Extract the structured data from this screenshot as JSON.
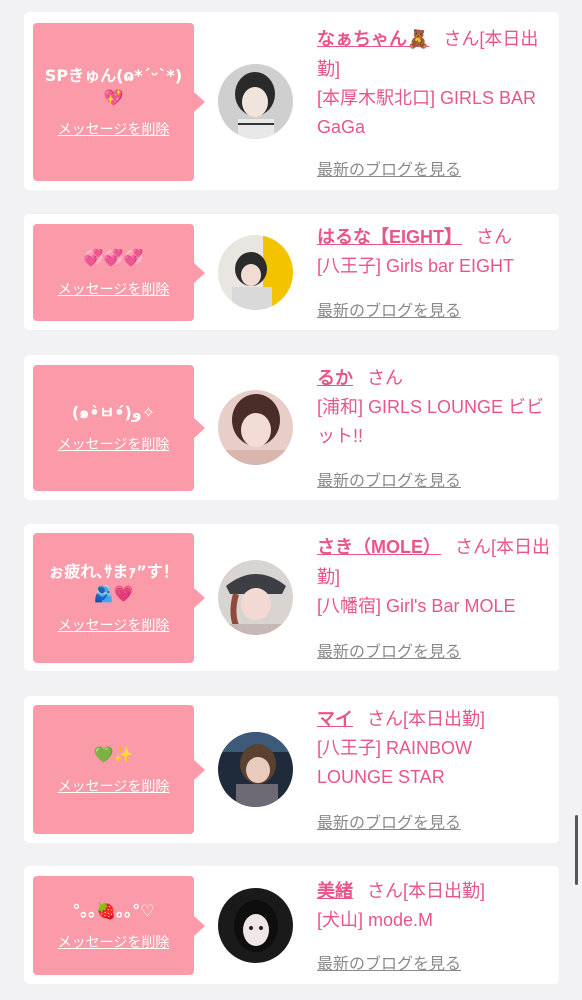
{
  "cards": [
    {
      "message": "SPきゅん(ɷ*ˊᵕˋ*)💖",
      "delete_label": "メッセージを削除",
      "name": "なぁちゃん🧸",
      "honorific": "さん[本日出勤]",
      "shop": "[本厚木駅北口] GIRLS BAR GaGa",
      "blog_label": "最新のブログを見る"
    },
    {
      "message": "💞💞💞",
      "delete_label": "メッセージを削除",
      "name": "はるな【EIGHT】",
      "honorific": "さん",
      "shop": "[八王子] Girls bar EIGHT",
      "blog_label": "最新のブログを見る"
    },
    {
      "message": "(๑•̀ㅂ•́)و✧",
      "delete_label": "メッセージを削除",
      "name": "るか",
      "honorific": "さん",
      "shop": "[浦和] GIRLS LOUNGE ビビット!!",
      "blog_label": "最新のブログを見る"
    },
    {
      "message": "ぉ疲れ､ｻまｧ”す！🫂💗",
      "delete_label": "メッセージを削除",
      "name": "さき（MOLE）",
      "honorific": "さん[本日出勤]",
      "shop": "[八幡宿] Girl's Bar MOLE",
      "blog_label": "最新のブログを見る"
    },
    {
      "message": "💚✨",
      "delete_label": "メッセージを削除",
      "name": "マイ",
      "honorific": "さん[本日出勤]",
      "shop": "[八王子] RAINBOW LOUNGE STAR",
      "blog_label": "最新のブログを見る"
    },
    {
      "message": "°｡｡🍓｡｡°♡",
      "delete_label": "メッセージを削除",
      "name": "美緒",
      "honorific": "さん[本日出勤]",
      "shop": "[犬山] mode.M",
      "blog_label": "最新のブログを見る"
    }
  ],
  "colors": {
    "bubble": "#fb9aa9",
    "accent": "#e8558a",
    "link_gray": "#8a8a8a",
    "background": "#f2f2f4"
  }
}
